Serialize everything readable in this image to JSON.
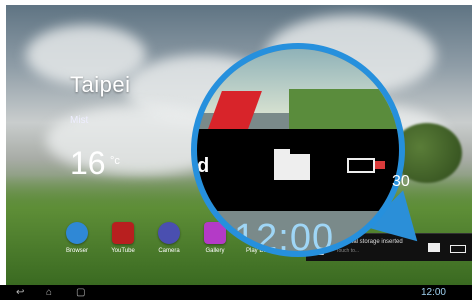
{
  "weather": {
    "city": "Taipei",
    "sub": "Mist",
    "temperature": "16",
    "unit": "°c"
  },
  "dock": [
    {
      "label": "Browser",
      "color": "#2f88d6"
    },
    {
      "label": "YouTube",
      "color": "#b81f1f"
    },
    {
      "label": "Camera",
      "color": "#4a4fb0"
    },
    {
      "label": "Gallery",
      "color": "#b43ac7"
    },
    {
      "label": "Play Books",
      "color": "#d9c8a8"
    }
  ],
  "notification": {
    "title": "External storage inserted",
    "subtitle": "Touch to..."
  },
  "systembar": {
    "time": "12:00",
    "back": "↩",
    "home": "⌂",
    "recent": "▢"
  },
  "zoom": {
    "time": "12:00",
    "partial_text": "d",
    "side_number": "30"
  },
  "colors": {
    "accent": "#2690dd"
  }
}
